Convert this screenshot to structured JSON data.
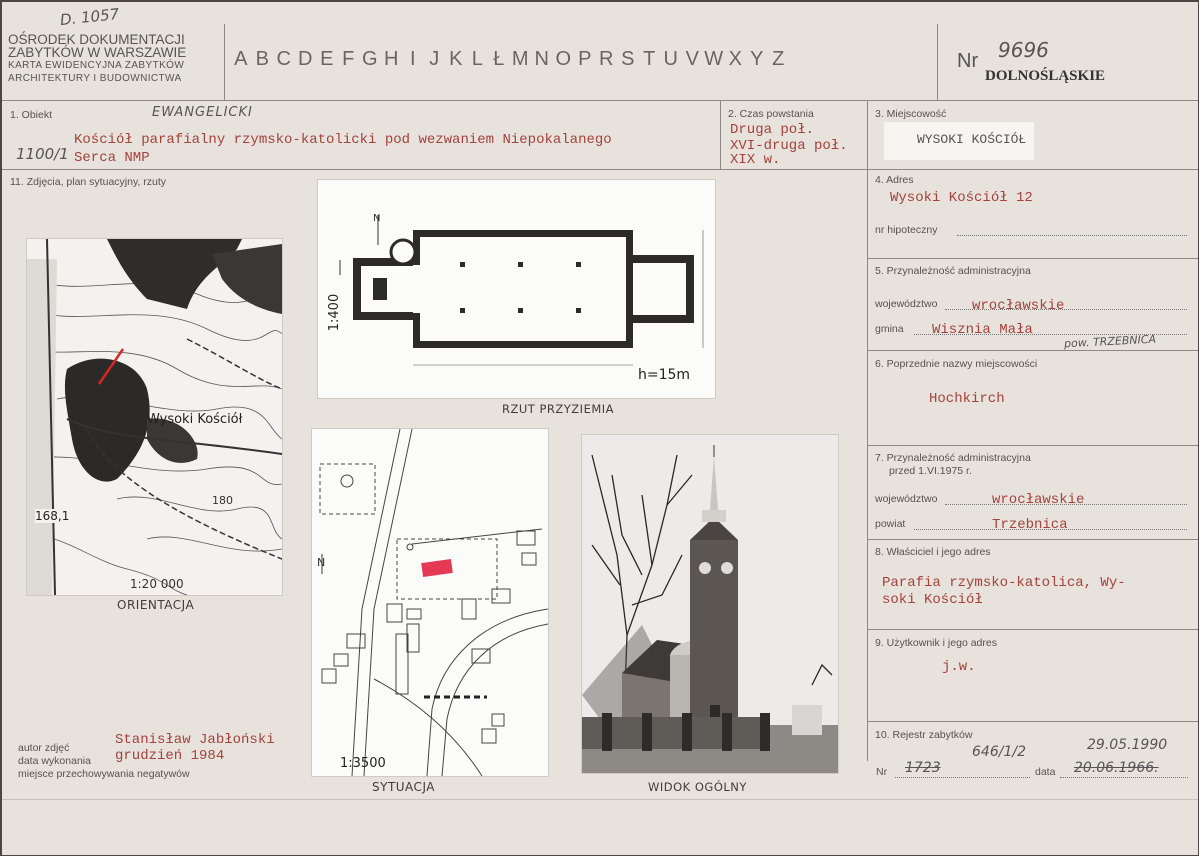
{
  "header": {
    "archive_ref": "D. 1057",
    "office_lines": [
      "OŚRODEK DOKUMENTACJI",
      "ZABYTKÓW W WARSZAWIE",
      "KARTA EWIDENCYJNA ZABYTKÓW",
      "ARCHITEKTURY I BUDOWNICTWA"
    ],
    "alphabet": [
      "A",
      "B",
      "C",
      "D",
      "E",
      "F",
      "G",
      "H",
      "I",
      "J",
      "K",
      "L",
      "Ł",
      "M",
      "N",
      "O",
      "P",
      "R",
      "S",
      "T",
      "U",
      "V",
      "W",
      "X",
      "Y",
      "Z"
    ],
    "nr_label": "Nr",
    "card_number": "9696",
    "voivodeship": "DOLNOŚLĄSKIE"
  },
  "field1": {
    "label": "1. Obiekt",
    "handwritten": "EWANGELICKI",
    "code": "1100/1",
    "text": "Kościół parafialny rzymsko-katolicki pod wezwaniem Niepokalanego",
    "text2": "Serca NMP"
  },
  "field2": {
    "label": "2. Czas powstania",
    "line1": "Druga poł.",
    "line2": "XVI-druga poł.",
    "line3": "XIX w."
  },
  "field3": {
    "label": "3. Miejscowość",
    "value": "WYSOKI KOŚCIÓŁ"
  },
  "field4": {
    "label": "4. Adres",
    "value": "Wysoki Kościół 12",
    "mortgage_label": "nr hipoteczny"
  },
  "field5": {
    "label": "5. Przynależność administracyjna",
    "voiv_label": "województwo",
    "voiv_value": "wrocławskie",
    "gmina_label": "gmina",
    "gmina_value": "Wisznia Mała",
    "powiat_note": "pow. TRZEBNICA"
  },
  "field6": {
    "label": "6. Poprzednie nazwy miejscowości",
    "value": "Hochkirch"
  },
  "field7": {
    "label": "7. Przynależność administracyjna",
    "sublabel": "przed 1.VI.1975 r.",
    "voiv_label": "województwo",
    "voiv_value": "wrocławskie",
    "powiat_label": "powiat",
    "powiat_value": "Trzebnica"
  },
  "field8": {
    "label": "8. Właściciel i jego adres",
    "line1": "Parafia rzymsko-katolica, Wy-",
    "line2": "soki Kościół"
  },
  "field9": {
    "label": "9. Użytkownik i jego adres",
    "value": "j.w."
  },
  "field10": {
    "label": "10. Rejestr zabytków",
    "nr_label": "Nr",
    "old_nr": "1723",
    "new_nr": "646/1/2",
    "date_label": "data",
    "old_date": "20.06.1966.",
    "new_date": "29.05.1990"
  },
  "field11": {
    "label": "11. Zdjęcia, plan sytuacyjny, rzuty"
  },
  "images": {
    "orientation": {
      "caption": "ORIENTACJA",
      "place": "Wysoki Kościół",
      "elev": "168,1",
      "contour": "180",
      "scale": "1:20 000"
    },
    "floorplan": {
      "caption": "RZUT PRZYZIEMIA",
      "scale": "1:400",
      "height": "h=15m",
      "north": "N"
    },
    "situation": {
      "caption": "SYTUACJA",
      "scale": "1:3500",
      "north": "N"
    },
    "view": {
      "caption": "WIDOK OGÓLNY"
    }
  },
  "credits": {
    "author_label": "autor zdjęć",
    "author_value": "Stanisław Jabłoński",
    "date_label": "data wykonania",
    "date_value": "grudzień 1984",
    "storage_label": "miejsce przechowywania negatywów"
  },
  "colors": {
    "paper": "#e7e2dc",
    "typed_red": "#a6413b",
    "ink": "#3f3c3a",
    "rule": "#8e8984"
  }
}
